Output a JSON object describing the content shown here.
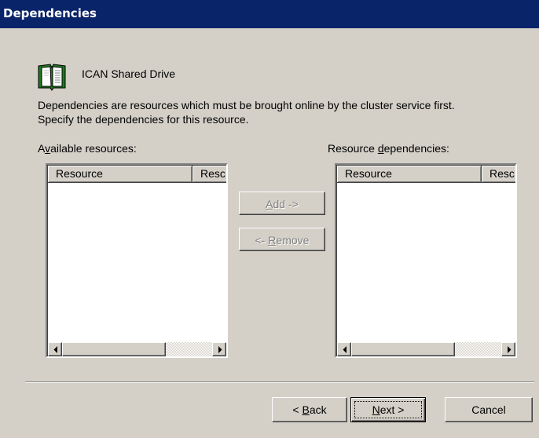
{
  "window": {
    "title": "Dependencies"
  },
  "resource": {
    "name": "ICAN Shared Drive",
    "icon": "book-icon"
  },
  "description": {
    "line1": "Dependencies are resources which must be brought online by the cluster service first.",
    "line2": "Specify the dependencies for this resource."
  },
  "available": {
    "label_pre": "A",
    "label_key": "v",
    "label_post": "ailable resources:",
    "columns": [
      "Resource",
      "Resc"
    ]
  },
  "dependencies": {
    "label_pre": "Resource ",
    "label_key": "d",
    "label_post": "ependencies:",
    "columns": [
      "Resource",
      "Resc"
    ]
  },
  "buttons": {
    "add_key": "A",
    "add_rest": "dd ->",
    "remove_pre": "<- ",
    "remove_key": "R",
    "remove_rest": "emove",
    "back_pre": "< ",
    "back_key": "B",
    "back_rest": "ack",
    "next_key": "N",
    "next_rest": "ext >",
    "cancel": "Cancel"
  },
  "colors": {
    "title_bar": "#0a246a",
    "face": "#d4d0c8",
    "list_bg": "#ffffff"
  }
}
